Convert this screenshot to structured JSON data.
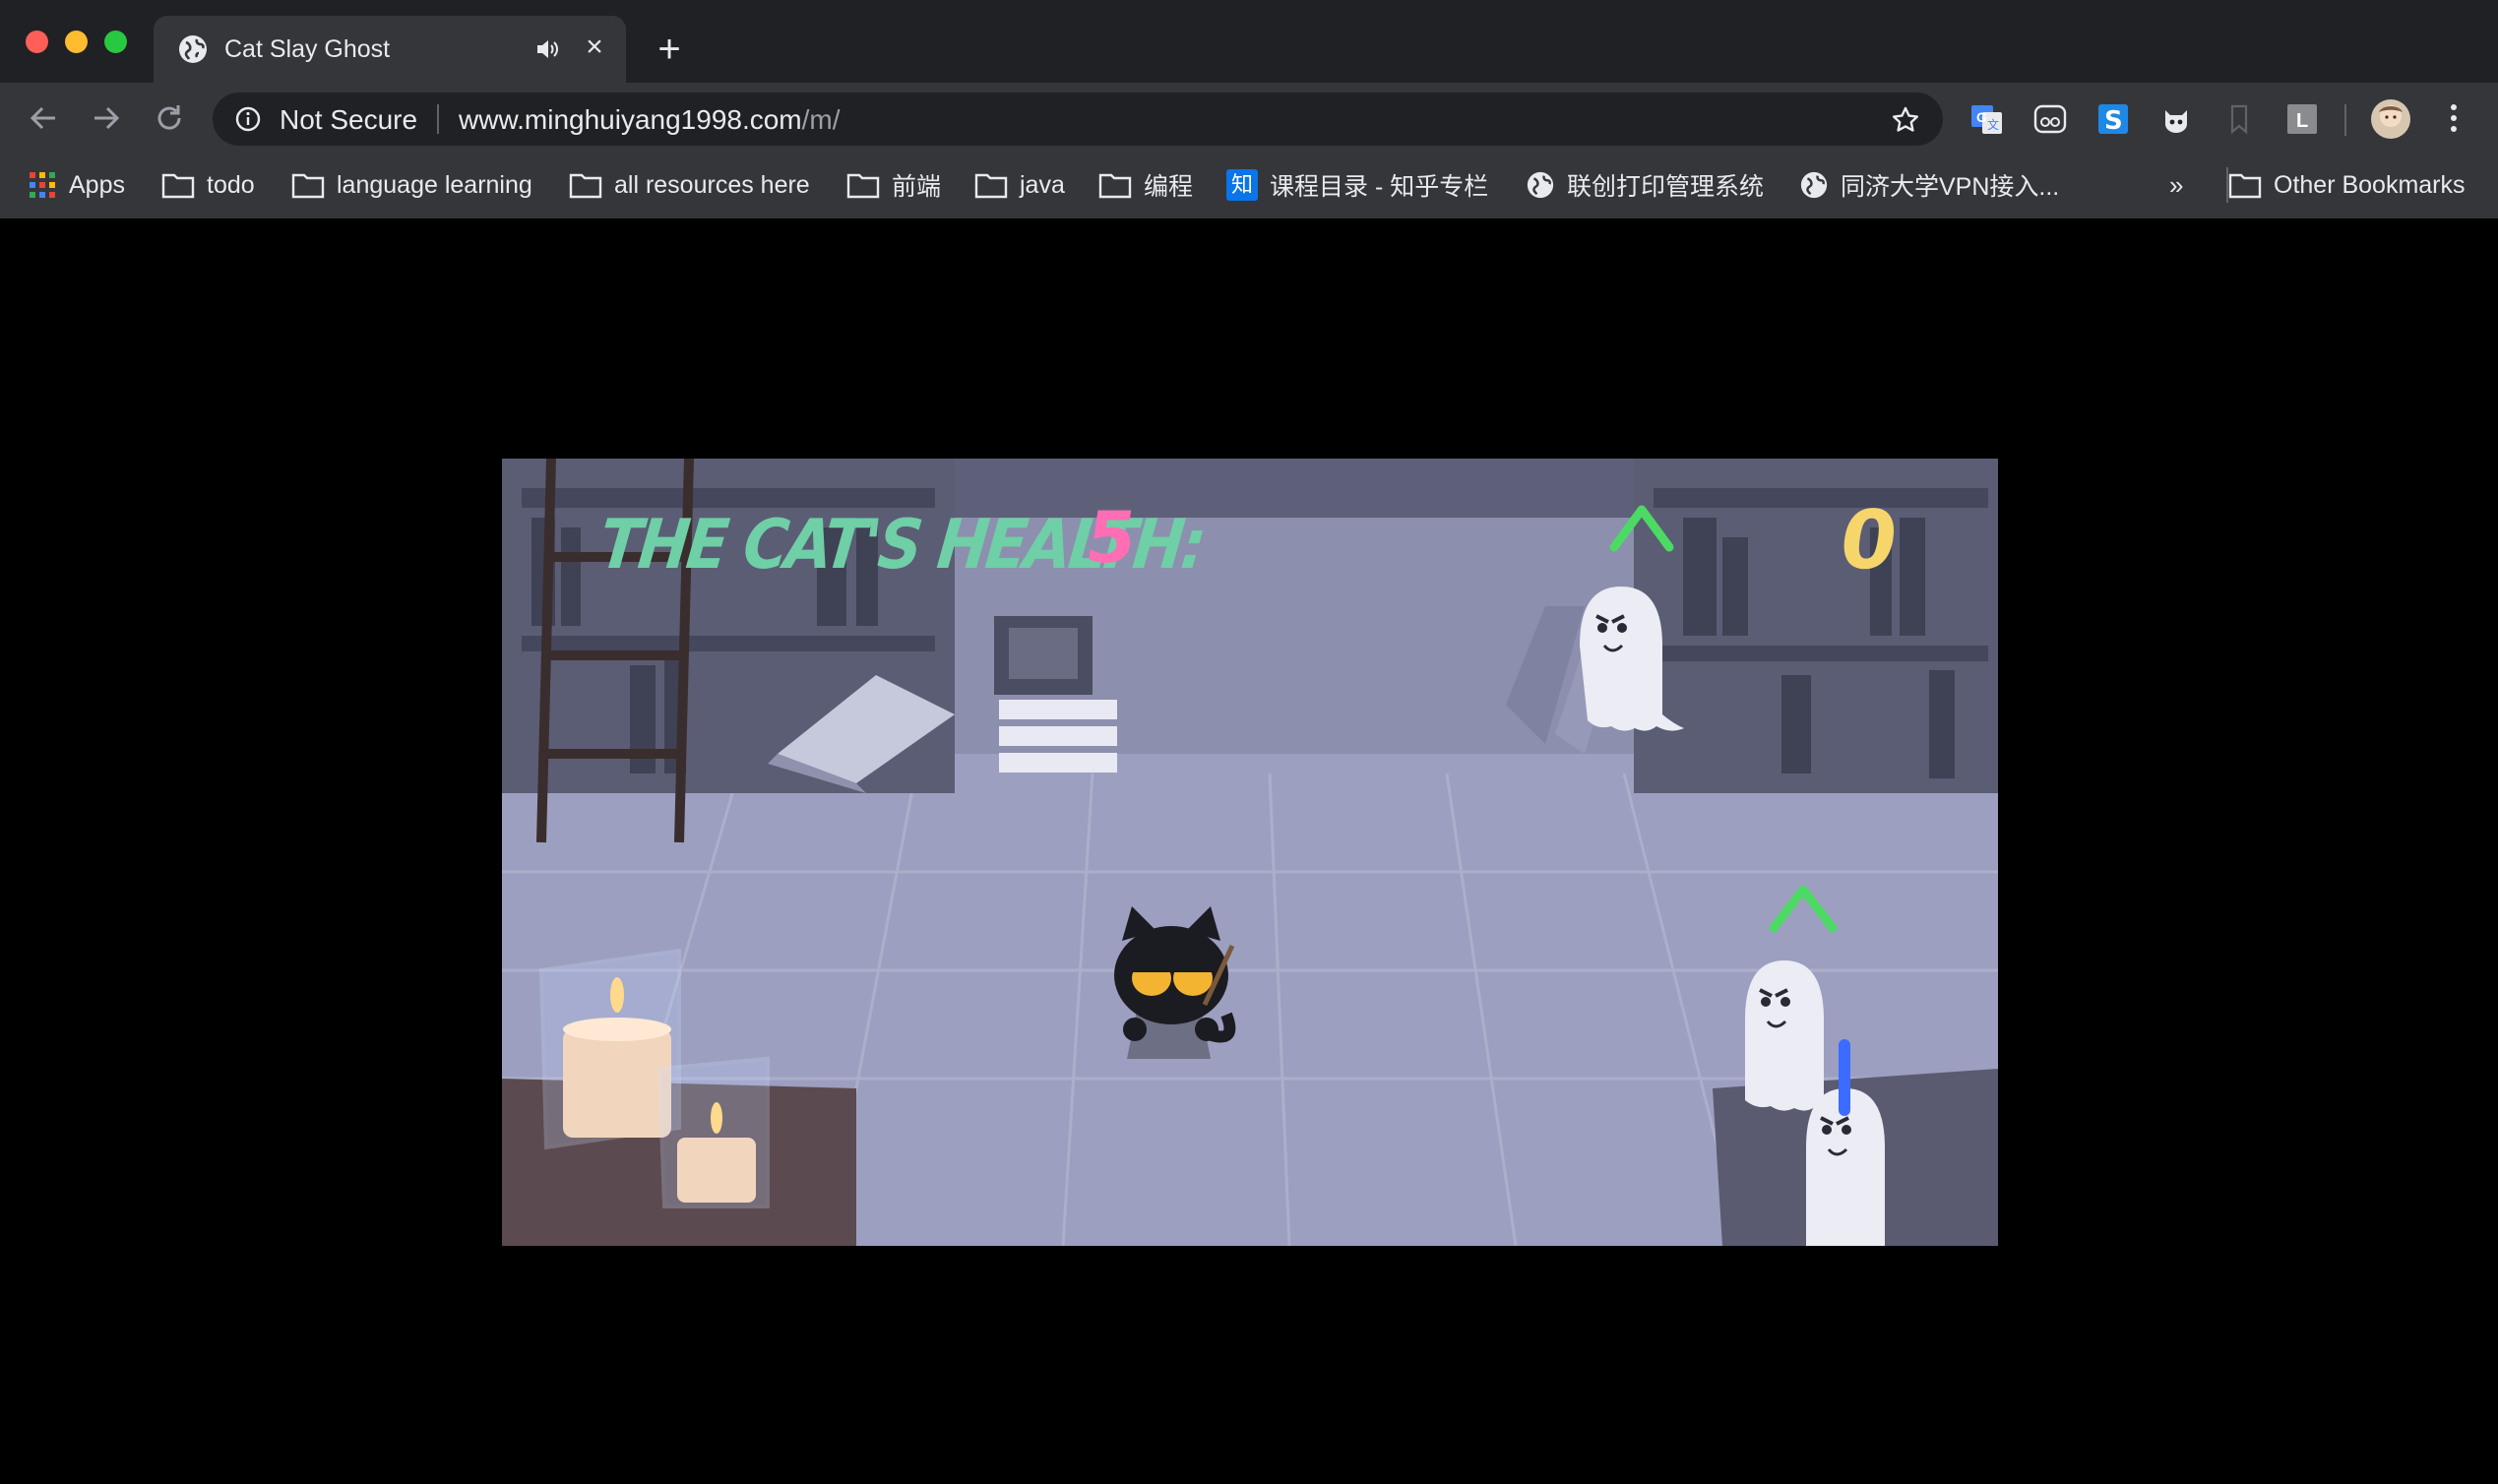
{
  "window": {
    "tab_title": "Cat Slay Ghost",
    "close_glyph": "×",
    "new_tab_glyph": "+"
  },
  "toolbar": {
    "security_label": "Not Secure",
    "url_host": "www.minghuiyang1998.com",
    "url_path": "/m/",
    "extensions": [
      "google-translate-icon",
      "eyes-icon",
      "s-icon",
      "cat-icon",
      "bookmark-icon",
      "l-icon",
      "avatar"
    ]
  },
  "bookmarks": {
    "items": [
      {
        "label": "Apps",
        "icon": "apps-grid-icon"
      },
      {
        "label": "todo",
        "icon": "folder-icon"
      },
      {
        "label": "language learning",
        "icon": "folder-icon"
      },
      {
        "label": "all resources here",
        "icon": "folder-icon"
      },
      {
        "label": "前端",
        "icon": "folder-icon"
      },
      {
        "label": "java",
        "icon": "folder-icon"
      },
      {
        "label": "编程",
        "icon": "folder-icon"
      },
      {
        "label": "课程目录 - 知乎专栏",
        "icon": "zhihu-icon",
        "icon_text": "知"
      },
      {
        "label": "联创打印管理系统",
        "icon": "globe-icon"
      },
      {
        "label": "同济大学VPN接入...",
        "icon": "globe-icon"
      }
    ],
    "overflow_glyph": "»",
    "other_label": "Other Bookmarks"
  },
  "game": {
    "health_label": "THE CAT'S HEALTH:",
    "health_value": "5",
    "score_value": "0",
    "ghost_symbols": [
      "^",
      "^",
      "|"
    ],
    "colors": {
      "health_label": "#6fcfa6",
      "health_value": "#ff6eb4",
      "score": "#f6d56b",
      "symbol_green": "#4cd964",
      "symbol_blue": "#3b6cff"
    }
  }
}
